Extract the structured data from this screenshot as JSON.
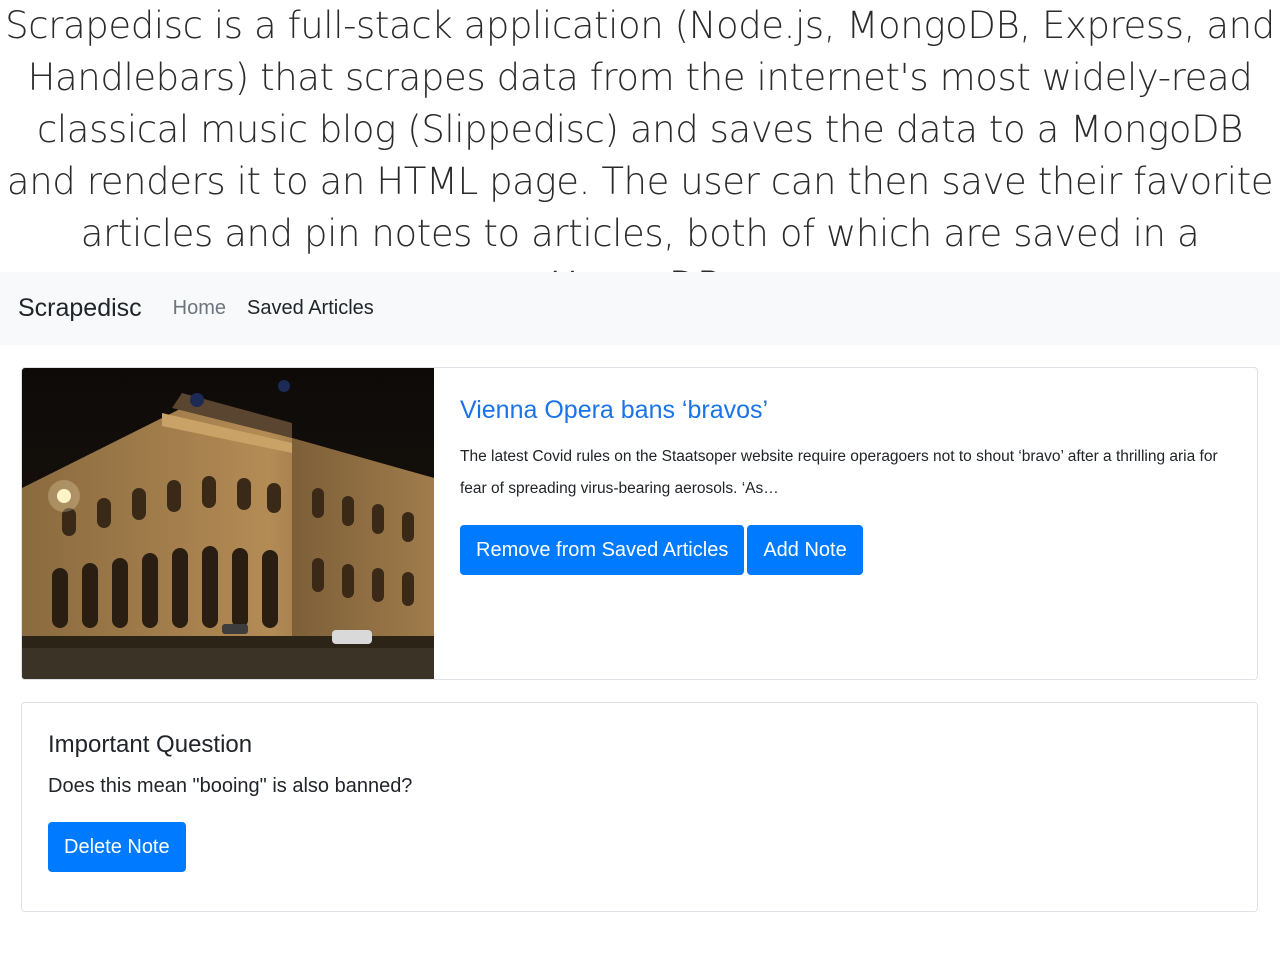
{
  "caption": "Scrapedisc is a full-stack application (Node.js, MongoDB, Express, and Handlebars) that scrapes data from the internet's most widely-read classical music blog (Slippedisc) and saves the data to a MongoDB and renders it to an HTML page.  The user can then save their favorite articles and pin notes to articles, both of which are saved in a MongoDB.",
  "navbar": {
    "brand": "Scrapedisc",
    "links": [
      {
        "label": "Home"
      },
      {
        "label": "Saved Articles"
      }
    ]
  },
  "article": {
    "title": "Vienna Opera bans ‘bravos’",
    "summary": "The latest Covid rules on the Staatsoper website require operagoers not to shout ‘bravo’ after a thrilling aria for fear of spreading virus-bearing aerosols. ‘As…",
    "image_icon": "opera-house-photo",
    "buttons": {
      "remove": "Remove from Saved Articles",
      "add_note": "Add Note"
    }
  },
  "note": {
    "title": "Important Question",
    "body": "Does this mean \"booing\" is also banned?",
    "delete": "Delete Note"
  },
  "colors": {
    "primary": "#007bff",
    "link": "#1a73e8",
    "navbar_bg": "#f8f9fa"
  }
}
